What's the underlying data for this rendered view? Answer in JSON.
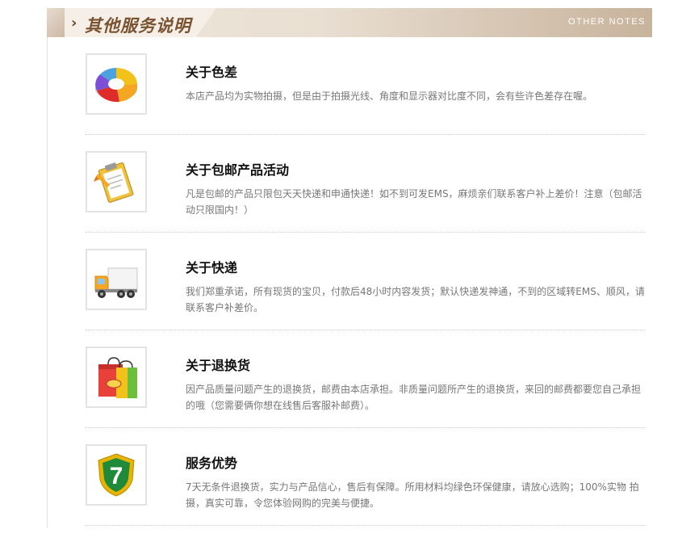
{
  "header": {
    "title": "其他服务说明",
    "subtitle": "OTHER NOTES",
    "chevron": "›"
  },
  "items": [
    {
      "icon": "color-wheel-icon",
      "title": "关于色差",
      "desc": "本店产品均为实物拍摄，但是由于拍摄光线、角度和显示器对比度不同，会有些许色差存在喔。"
    },
    {
      "icon": "clipboard-icon",
      "title": "关于包邮产品活动",
      "desc": "凡是包邮的产品只限包天天快递和申通快递！如不到可发EMS，麻烦亲们联系客户补上差价！注意（包邮活动只限国内！）"
    },
    {
      "icon": "delivery-truck-icon",
      "title": "关于快递",
      "desc": "我们郑重承诺，所有现货的宝贝，付款后48小时内容发货；默认快递发神通，不到的区域转EMS、顺风，请联系客户补差价。"
    },
    {
      "icon": "shopping-bags-icon",
      "title": "关于退换货",
      "desc": "因产品质量问题产生的退换货，邮费由本店承担。非质量问题所产生的退换货，来回的邮费都要您自己承担的哦（您需要俩你想在线售后客服补邮费）。"
    },
    {
      "icon": "seven-day-shield-icon",
      "title": "服务优势",
      "desc": "7天无条件退换货，实力与产品信心，售后有保障。所用材料均绿色环保健康，请放心选购；100%实物 拍摄，真实可靠，令您体验网购的完美与便捷。",
      "badge": "7"
    }
  ]
}
